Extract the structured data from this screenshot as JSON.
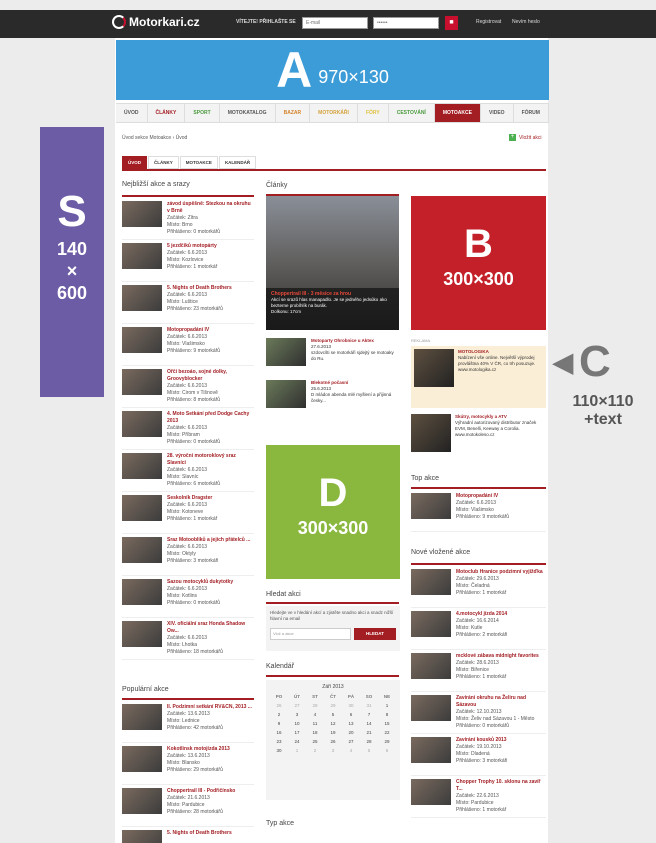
{
  "header": {
    "logo": "Motorkari.cz",
    "login_label": "VÍTEJTE! PŘIHLAŠTE SE",
    "email_placeholder": "E-mail",
    "password_placeholder": "••••••",
    "register": "Registrovat",
    "forgot": "Nevím heslo"
  },
  "banner_a": {
    "big": "A",
    "size": "970×130"
  },
  "nav": [
    "ÚVOD",
    "ČLÁNKY",
    "SPORT",
    "MOTOKATALOG",
    "BAZAR",
    "MOTORKÁŘI",
    "FÓRY",
    "CESTOVÁNÍ",
    "MOTOAKCE",
    "VIDEO",
    "FÓRUM"
  ],
  "nav_colors": [
    "#555555",
    "#a31e23",
    "#4a9a3e",
    "#555555",
    "#d4822a",
    "#d4a23a",
    "#e0c040",
    "#4a9a3e",
    "#ffffff",
    "#555555",
    "#555555"
  ],
  "breadcrumb": "Úvod sekce Motoakce › Úvod",
  "add_event": "Vložit akci",
  "subtabs": [
    "ÚVOD",
    "ČLÁNKY",
    "MOTOAKCE",
    "KALENDÁŘ"
  ],
  "nearest": {
    "title": "Nejbližší akce a srazy",
    "items": [
      {
        "title": "závod úspěšně: Stezkou na okruhu v Brně",
        "start": "Začátek: Zítra",
        "place": "Místo: Brno",
        "signed": "Přihlášeno: 0 motorkářů"
      },
      {
        "title": "5 jezdčíků motopárty",
        "start": "Začátek: 6.6.2013",
        "place": "Místo: Kozlovice",
        "signed": "Přihlášeno: 1 motorkář"
      },
      {
        "title": "5. Nights of Death Brothers",
        "start": "Začátek: 6.6.2013",
        "place": "Místo: Luštice",
        "signed": "Přihlášeno: 23 motorkářů"
      },
      {
        "title": "Motopropadání IV",
        "start": "Začátek: 6.6.2013",
        "place": "Místo: Vlašimsko",
        "signed": "Přihlášeno: 9 motorkářů"
      },
      {
        "title": "Ořčí bezoáo, sojné dolky, Groovyblocker",
        "start": "Začátek: 6.6.2013",
        "place": "Místo: Cirom v Tišnově",
        "signed": "Přihlášeno: 8 motorkářů"
      },
      {
        "title": "4. Moto Setkání před Dodge Cachy 2013",
        "start": "Začátek: 6.6.2013",
        "place": "Místo: Příbram",
        "signed": "Přihlášeno: 0 motorkářů"
      },
      {
        "title": "28. výroční motoroklový sraz Slavníci",
        "start": "Začátek: 6.6.2013",
        "place": "Místo: Slavníc",
        "signed": "Přihlášeno: 6 motorkářů"
      },
      {
        "title": "Seskolník Dragster",
        "start": "Začátek: 6.6.2013",
        "place": "Místo: Kotoneve",
        "signed": "Přihlášeno: 1 motorkář"
      },
      {
        "title": "Sraz Motoobliků a jejich přátelců ...",
        "start": "Začátek: 6.6.2013",
        "place": "Místo: Oktyly",
        "signed": "Přihlášeno: 3 motorkáři"
      },
      {
        "title": "Sazou motocyklů dukytotky",
        "start": "Začátek: 6.6.2013",
        "place": "Místo: Kotlins",
        "signed": "Přihlášeno: 0 motorkářů"
      },
      {
        "title": "XIV. oficiální sraz Honda Shadow Ow...",
        "start": "Začátek: 6.6.2013",
        "place": "Místo: Lhotka",
        "signed": "Přihlášeno: 18 motorkářů"
      }
    ]
  },
  "popular": {
    "title": "Populární akce",
    "items": [
      {
        "title": "II. Podzimní setkání RV&CN, 2013 ...",
        "start": "Začátek: 13.6.2013",
        "place": "Místo: Lednice",
        "signed": "Přihlášeno: 42 motorkářů"
      },
      {
        "title": "Kokotlinsk motojízda 2013",
        "start": "Začátek: 13.6.2013",
        "place": "Místo: Blansko",
        "signed": "Přihlášeno: 29 motorkářů"
      },
      {
        "title": "Choppertrail III - Podřičínsko",
        "start": "Začátek: 21.6.2013",
        "place": "Místo: Pardubice",
        "signed": "Přihlášeno: 28 motorkářů"
      },
      {
        "title": "5. Nights of Death Brothers",
        "start": "",
        "place": "",
        "signed": ""
      }
    ]
  },
  "articles": {
    "title": "Články",
    "main_title": "Choppertrail III - 3 měsíce za hrou",
    "main_text": "Akcí se srazů hlas manapadlo. Je se jedného jedsúko ako bezterne probíhlík na burák.",
    "main_more": "Dolkonu: 17cm",
    "small": [
      {
        "title": "Motoparty Ohrobnice u Aktex",
        "date": "27.6.2013",
        "text": "szdovcšti se motorkáři sjdejtý se motoaky do Ru."
      },
      {
        "title": "Blekotné počasní",
        "date": "25.6.2013",
        "text": "D mládon abenda mlé myšlení a přijinná česky..."
      }
    ]
  },
  "box_b": {
    "big": "B",
    "size": "300×300"
  },
  "box_d": {
    "big": "D",
    "size": "300×300"
  },
  "promos": [
    {
      "title": "MOTOLOGIKA",
      "text": "Nabízení vše online. Největší výprodej provláštna 40% V ČR, co trh posuzuje. www.motologika.cz"
    },
    {
      "title": "Skútry, motocykly a ATV",
      "text": "Výhradní autorizovaný distributor značek EVM, Benelli, Keeway a Corolia. www.motokoleso.cz"
    }
  ],
  "reklama": "REKLAMA",
  "top_actions": {
    "title": "Top akce",
    "items": [
      {
        "title": "Motopropadání IV",
        "start": "Začátek: 6.6.2013",
        "place": "Místo: Vlašimsko",
        "signed": "Přihlášeno: 9 motorkářů"
      }
    ]
  },
  "new_actions": {
    "title": "Nové vložené akce",
    "items": [
      {
        "title": "Motoclub Hranice podzimní vyjížďka",
        "start": "Začátek: 29.6.2013",
        "place": "Místo: Čeladná",
        "signed": "Přihlášeno: 1 motorkář"
      },
      {
        "title": "4.motocykl jízda 2014",
        "start": "Začátek: 16.6.2014",
        "place": "Místo: Kutle",
        "signed": "Přihlášeno: 2 motorkáři"
      },
      {
        "title": "mcklové zábava midnight favorites",
        "start": "Začátek: 28.6.2013",
        "place": "Místo: Biřenice",
        "signed": "Přihlášeno: 1 motorkář"
      },
      {
        "title": "Zavírání okruhu na Želiru nad Sázavou",
        "start": "Začátek: 12.10.2013",
        "place": "Místo: Želiv nad Sázavou 1 - Město",
        "signed": "Přihlášeno: 0 motorkářů"
      },
      {
        "title": "Zavírání kousků 2013",
        "start": "Začátek: 19.10.2013",
        "place": "Místo: Dladená",
        "signed": "Přihlášeno: 3 motorkáři"
      },
      {
        "title": "Chopper Trophy 10. sklonu na zavíř T...",
        "start": "Začátek: 22.6.2013",
        "place": "Místo: Pardubice",
        "signed": "Přihlášeno: 1 motorkář"
      }
    ]
  },
  "search": {
    "title": "Hledat akci",
    "text": "Hledejte ve v hledání akcí a zjistěte snadno akci a snadz nižší hlavní na email",
    "placeholder": "Vlož a akce",
    "button": "HLEDAT"
  },
  "calendar": {
    "title": "Kalendář",
    "month": "Září 2013",
    "days": [
      "PO",
      "ÚT",
      "ST",
      "ČT",
      "PÁ",
      "SO",
      "NE"
    ],
    "cells": [
      "26",
      "27",
      "28",
      "29",
      "30",
      "31",
      "1",
      "2",
      "3",
      "4",
      "5",
      "6",
      "7",
      "8",
      "9",
      "10",
      "11",
      "12",
      "13",
      "14",
      "15",
      "16",
      "17",
      "18",
      "19",
      "20",
      "21",
      "22",
      "23",
      "24",
      "25",
      "26",
      "27",
      "28",
      "29",
      "30",
      "1",
      "2",
      "3",
      "4",
      "5",
      "6"
    ]
  },
  "type_akce": "Typ akce",
  "label_s": {
    "big": "S",
    "line1": "140",
    "line2": "×",
    "line3": "600"
  },
  "label_c": {
    "big": "C",
    "line1": "110×110",
    "line2": "+text"
  }
}
